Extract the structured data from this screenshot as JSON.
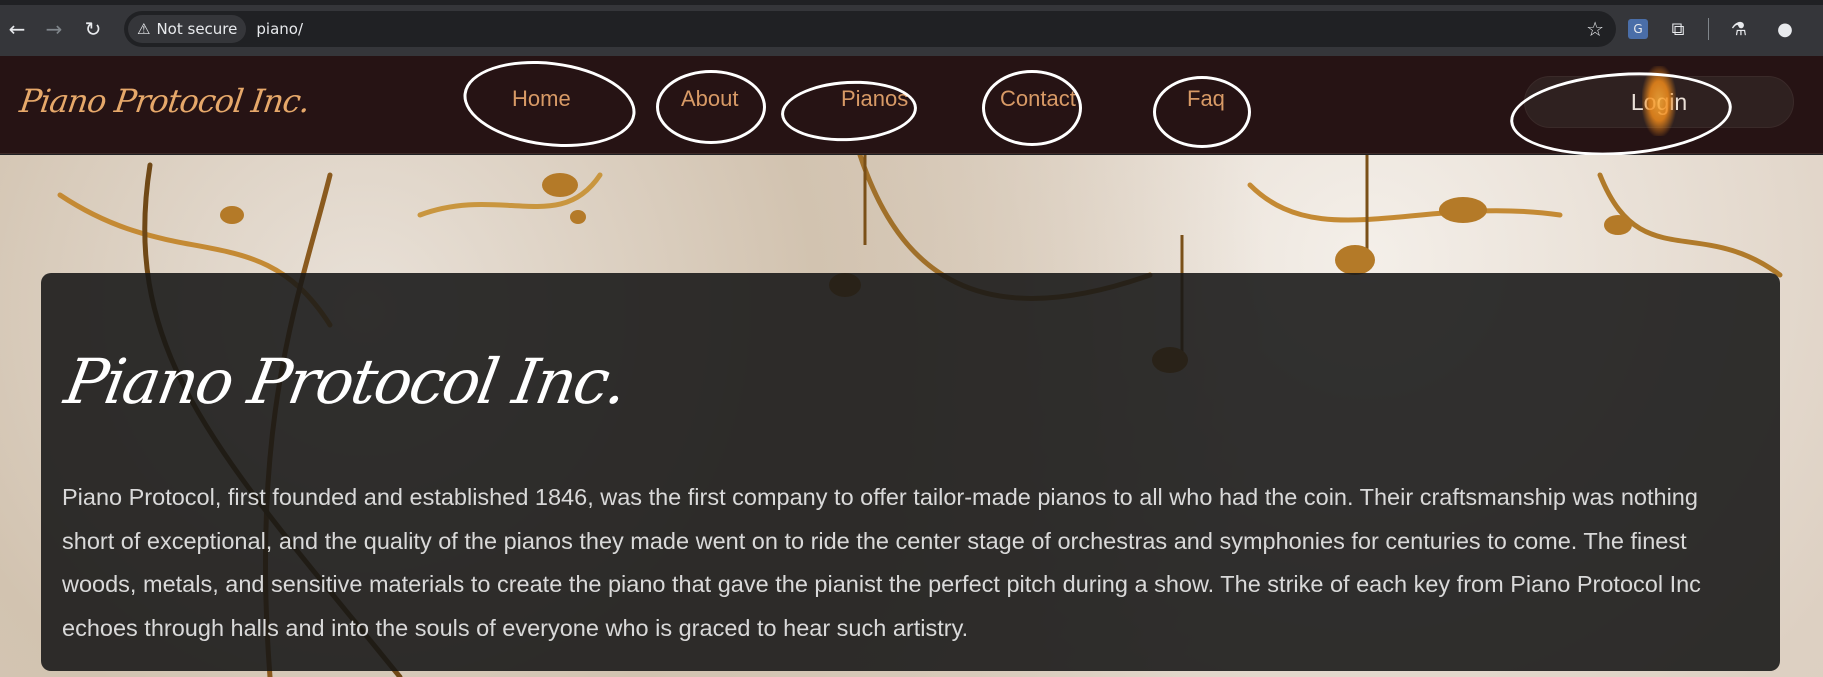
{
  "browser": {
    "security_label": "Not secure",
    "url": "piano/"
  },
  "site": {
    "brand": "Piano Protocol Inc.",
    "nav": {
      "home": "Home",
      "about": "About",
      "pianos": "Pianos",
      "contact": "Contact",
      "faq": "Faq",
      "login": "Login"
    }
  },
  "hero": {
    "title": "Piano Protocol Inc.",
    "description": "Piano Protocol, first founded and established 1846, was the first company to offer tailor-made pianos to all who had the coin. Their craftsmanship was nothing short of exceptional, and the quality of the pianos they made went on to ride the center stage of orchestras and symphonies for centuries to come. The finest woods, metals, and sensitive materials to create the piano that gave the pianist the perfect pitch during a show. The strike of each key from Piano Protocol Inc echoes through halls and into the souls of everyone who is graced to hear such artistry."
  },
  "colors": {
    "nav_bg": "#261314",
    "nav_link": "#d89a66",
    "brand": "#e6a86a",
    "card_bg": "#161616"
  }
}
